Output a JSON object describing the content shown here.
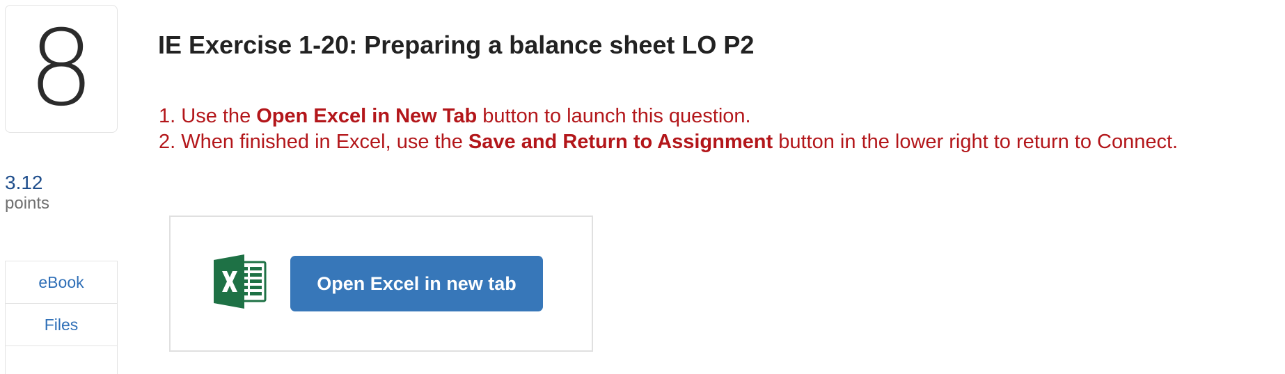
{
  "question": {
    "number": "8",
    "points_value": "3.12",
    "points_label": "points",
    "title": "IE Exercise 1-20: Preparing a balance sheet LO P2"
  },
  "sidebar": {
    "items": [
      {
        "label": "eBook"
      },
      {
        "label": "Files"
      }
    ]
  },
  "instructions": [
    {
      "num": "1. ",
      "pre": "Use the ",
      "bold": "Open Excel in New Tab",
      "post": " button to launch this question."
    },
    {
      "num": "2. ",
      "pre": "When finished in Excel, use the ",
      "bold": "Save and Return to Assignment",
      "post": " button in the lower right to return to Connect."
    }
  ],
  "excel": {
    "icon": "excel-icon",
    "button_label": "Open Excel in new tab"
  },
  "colors": {
    "instruction_red": "#b3161a",
    "button_blue": "#3777b9",
    "link_blue": "#2f6fb7",
    "points_blue": "#1f4e8c",
    "excel_green": "#1e7145"
  }
}
